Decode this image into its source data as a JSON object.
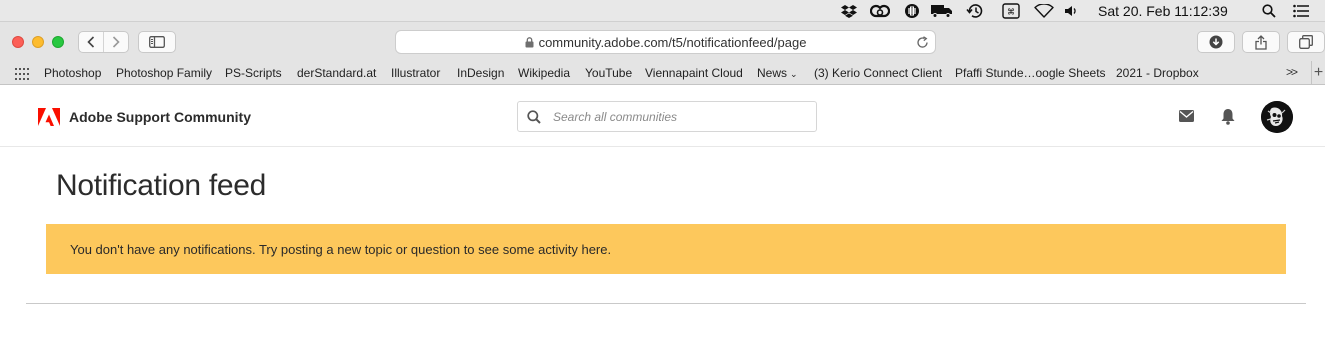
{
  "menubar": {
    "clock": "Sat 20. Feb  11:12:39",
    "status_icons": [
      "dropbox-icon",
      "creative-cloud-icon",
      "vpn-icon",
      "truck-icon",
      "time-machine-icon",
      "keyboard-icon",
      "wifi-icon",
      "volume-icon",
      "spotlight-icon",
      "list-icon"
    ]
  },
  "browser": {
    "url": "community.adobe.com/t5/notificationfeed/page",
    "bookmarks": [
      "Photoshop",
      "Photoshop Family",
      "PS-Scripts",
      "derStandard.at",
      "Illustrator",
      "InDesign",
      "Wikipedia",
      "YouTube",
      "Viennapaint Cloud",
      "News",
      "(3) Kerio Connect Client",
      "Pfaffi Stunde…oogle Sheets",
      "2021 - Dropbox"
    ],
    "more_label": ">>",
    "plus_label": "+"
  },
  "site": {
    "title": "Adobe Support Community",
    "search_placeholder": "Search all communities",
    "brand_color": "#fa0f00"
  },
  "main": {
    "page_title": "Notification feed",
    "notice": "You don't have any notifications. Try posting a new topic or question to see some activity here.",
    "notice_color": "#fdc85c"
  }
}
